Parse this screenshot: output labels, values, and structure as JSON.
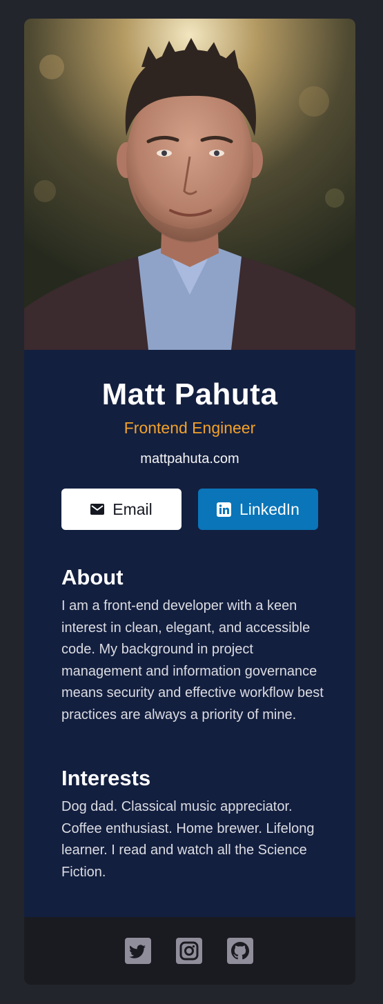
{
  "profile": {
    "name": "Matt Pahuta",
    "title": "Frontend Engineer",
    "website": "mattpahuta.com"
  },
  "buttons": {
    "email_label": "Email",
    "linkedin_label": "LinkedIn"
  },
  "about": {
    "heading": "About",
    "text": "I am a front-end developer with a keen interest in clean, elegant, and accessible code. My background in project management and information governance means security and effective workflow best practices are always a priority of mine."
  },
  "interests": {
    "heading": "Interests",
    "text": "Dog dad. Classical music appreciator. Coffee enthusiast. Home brewer. Lifelong learner. I read and watch all the Science Fiction."
  },
  "footer": {
    "icons": [
      "twitter-icon",
      "instagram-icon",
      "github-icon"
    ]
  },
  "colors": {
    "page_background": "#23252c",
    "info_background": "#131f3f",
    "accent_orange": "#f3a22c",
    "linkedin_blue": "#0a75b8",
    "footer_background": "#1a1b21",
    "social_icon": "#918e9b"
  }
}
